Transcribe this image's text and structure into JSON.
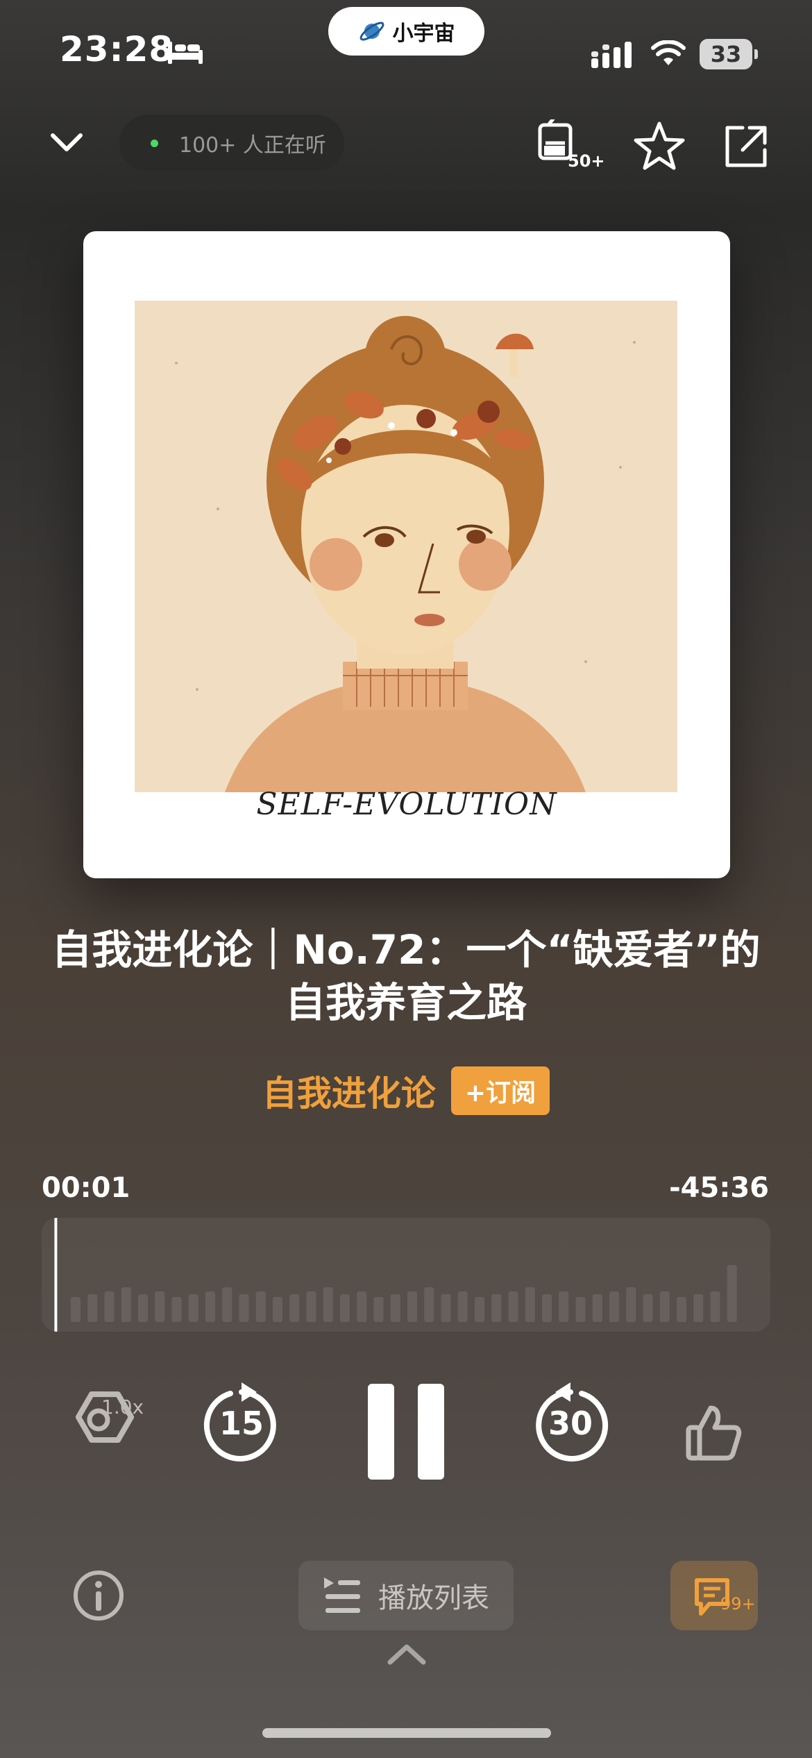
{
  "status_bar": {
    "time": "23:28",
    "app_pill_label": "小宇宙",
    "battery_level": "33",
    "icons": [
      "bed-icon",
      "signal-icon",
      "wifi-icon",
      "battery-icon"
    ]
  },
  "header": {
    "listeners_text": "100+ 人正在听",
    "vote_badge": "50+",
    "icons": [
      "chevron-down-icon",
      "vote-icon",
      "star-icon",
      "share-icon"
    ]
  },
  "cover": {
    "caption": "SELF-EVOLUTION"
  },
  "episode": {
    "title_line1": "自我进化论｜No.72：一个“缺爱者”的",
    "title_line2": "自我养育之路",
    "show_name": "自我进化论",
    "subscribe_label": "+订阅"
  },
  "player": {
    "elapsed": "00:01",
    "remaining": "-45:36",
    "progress_fraction": 0.0004,
    "speed_label": "1.0x",
    "rewind_seconds": "15",
    "forward_seconds": "30",
    "state": "playing"
  },
  "bottom": {
    "playlist_label": "播放列表",
    "comment_count": "99+"
  },
  "colors": {
    "accent": "#f0a03c",
    "live_dot": "#4cd964",
    "cover_background": "#f1dec2"
  }
}
